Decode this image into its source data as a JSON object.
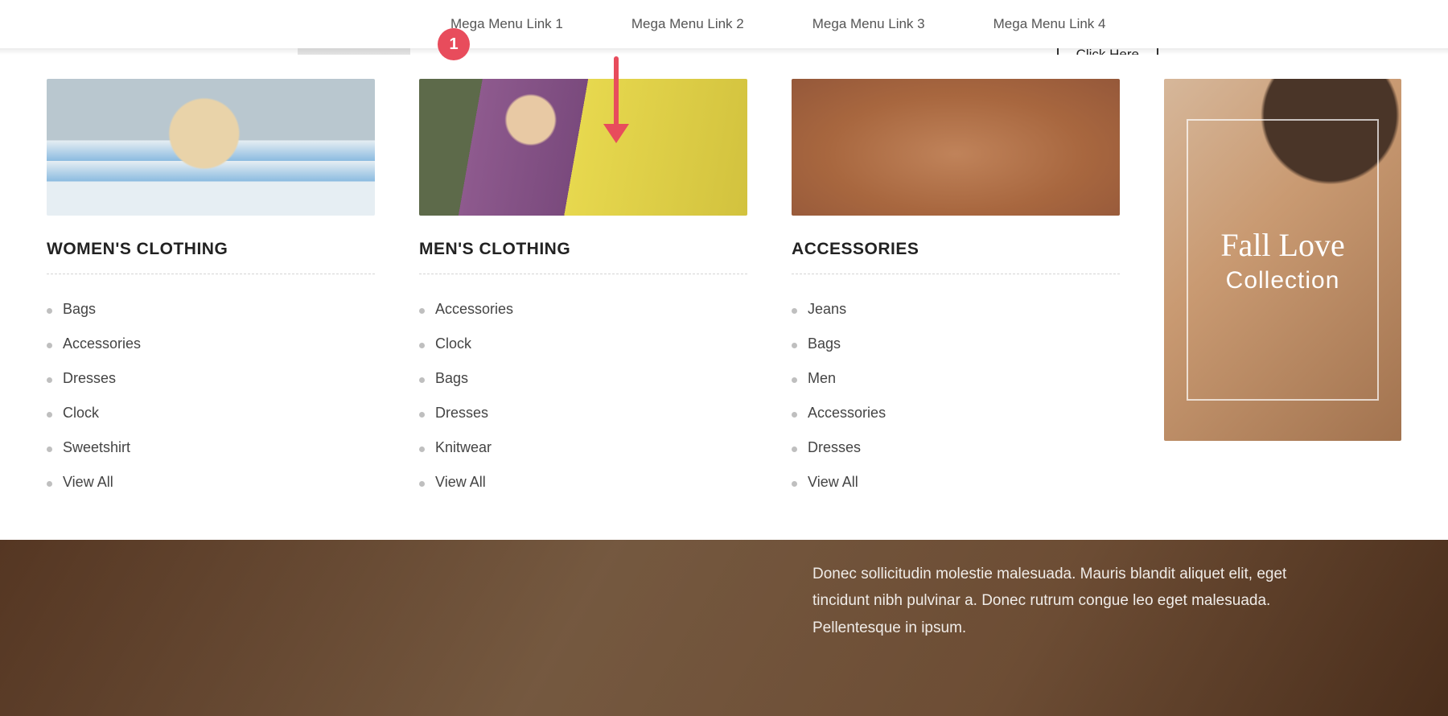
{
  "annotation": {
    "badge": "1"
  },
  "nav": {
    "links": [
      "Mega Menu Link 1",
      "Mega Menu Link 2",
      "Mega Menu Link 3",
      "Mega Menu Link 4"
    ],
    "cta": "Click Here"
  },
  "mega": {
    "columns": [
      {
        "title": "WOMEN'S CLOTHING",
        "items": [
          "Bags",
          "Accessories",
          "Dresses",
          "Clock",
          "Sweetshirt",
          "View All"
        ]
      },
      {
        "title": "MEN'S CLOTHING",
        "items": [
          "Accessories",
          "Clock",
          "Bags",
          "Dresses",
          "Knitwear",
          "View All"
        ]
      },
      {
        "title": "ACCESSORIES",
        "items": [
          "Jeans",
          "Bags",
          "Men",
          "Accessories",
          "Dresses",
          "View All"
        ]
      }
    ],
    "promo": {
      "line1": "Fall Love",
      "line2": "Collection"
    }
  },
  "hero": {
    "copy": "Donec sollicitudin molestie malesuada. Mauris blandit aliquet elit, eget tincidunt nibh pulvinar a. Donec rutrum congue leo eget malesuada. Pellentesque in ipsum."
  }
}
